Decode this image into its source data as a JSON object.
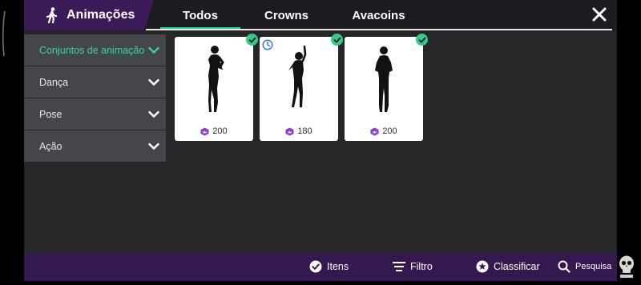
{
  "header": {
    "title": "Animações",
    "title_icon": "walking-person-icon",
    "tabs": [
      {
        "label": "Todos",
        "active": true
      },
      {
        "label": "Crowns",
        "active": false
      },
      {
        "label": "Avacoins",
        "active": false
      }
    ],
    "close_icon": "close-icon"
  },
  "sidebar": {
    "items": [
      {
        "label": "Conjuntos de animação",
        "active": true
      },
      {
        "label": "Dança",
        "active": false
      },
      {
        "label": "Pose",
        "active": false
      },
      {
        "label": "Ação",
        "active": false
      }
    ]
  },
  "items": [
    {
      "price": "200",
      "owned": true,
      "timed": false,
      "icon": "female-pose-silhouette-icon"
    },
    {
      "price": "180",
      "owned": true,
      "timed": true,
      "icon": "female-pose-silhouette-icon"
    },
    {
      "price": "200",
      "owned": true,
      "timed": false,
      "icon": "female-pose-silhouette-icon"
    }
  ],
  "bottom_bar": {
    "items_label": "Itens",
    "filter_label": "Filtro",
    "sort_label": "Classificar",
    "search_label": "Pesquisa"
  },
  "colors": {
    "accent": "#35d08e",
    "bar_purple": "#34184f",
    "title_purple": "#3a1a57",
    "background": "#262629",
    "sidebar_item": "#44464b"
  }
}
